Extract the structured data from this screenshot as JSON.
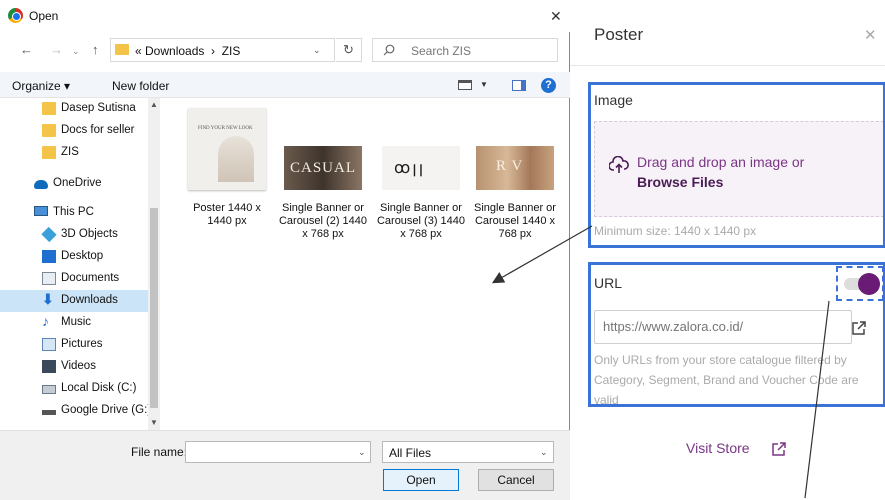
{
  "dialog": {
    "title": "Open",
    "close_label": "✕",
    "nav": {
      "back": "←",
      "forward": "→",
      "recent": "⌄",
      "up": "↑"
    },
    "address": {
      "path": "« Downloads  ›  ZIS",
      "dropdown": "⌄"
    },
    "refresh": "↻",
    "search_placeholder": "Search ZIS",
    "toolbar": {
      "organize": "Organize ▾",
      "new_folder": "New folder",
      "help": "?"
    },
    "nav_pane": {
      "items": [
        {
          "label": "Dasep Sutisna",
          "icon": "folder-icon"
        },
        {
          "label": "Docs for seller",
          "icon": "folder-icon"
        },
        {
          "label": "ZIS",
          "icon": "folder-icon"
        },
        {
          "label": "OneDrive",
          "icon": "cloud-icon"
        },
        {
          "label": "This PC",
          "icon": "pc-icon"
        },
        {
          "label": "3D Objects",
          "icon": "3d-objects-icon"
        },
        {
          "label": "Desktop",
          "icon": "desktop-icon"
        },
        {
          "label": "Documents",
          "icon": "documents-icon"
        },
        {
          "label": "Downloads",
          "icon": "downloads-icon",
          "selected": true
        },
        {
          "label": "Music",
          "icon": "music-icon"
        },
        {
          "label": "Pictures",
          "icon": "pictures-icon"
        },
        {
          "label": "Videos",
          "icon": "videos-icon"
        },
        {
          "label": "Local Disk (C:)",
          "icon": "disk-icon"
        },
        {
          "label": "Google Drive (G:)",
          "icon": "drive-icon"
        }
      ]
    },
    "files": [
      {
        "name": "Poster 1440 x 1440 px",
        "thumb_text": "FIND YOUR NEW LOOK"
      },
      {
        "name": "Single Banner or Carousel (2) 1440 x 768 px",
        "thumb_text": "CASUAL"
      },
      {
        "name": "Single Banner or Carousel (3) 1440 x 768 px",
        "thumb_text": "ꝏꞁꞁ"
      },
      {
        "name": "Single Banner or Carousel 1440 x 768 px",
        "thumb_text": "R V"
      }
    ],
    "file_name_label": "File name:",
    "file_name_value": "",
    "file_type": "All Files",
    "open_button": "Open",
    "cancel_button": "Cancel"
  },
  "poster": {
    "title": "Poster",
    "close_label": "✕",
    "image_label": "Image",
    "drop_line1": "Drag and drop an image or",
    "drop_line2": "Browse Files",
    "min_size": "Minimum size: 1440 x 1440 px",
    "url_label": "URL",
    "url_toggle_on": true,
    "url_placeholder": "https://www.zalora.co.id/",
    "url_help": "Only URLs from your store catalogue filtered by Category, Segment, Brand and Voucher Code are valid",
    "visit_store": "Visit Store"
  },
  "colors": {
    "accent_purple": "#6a1b76",
    "highlight_blue": "#3a72d6",
    "selection_blue": "#cce4f7"
  }
}
